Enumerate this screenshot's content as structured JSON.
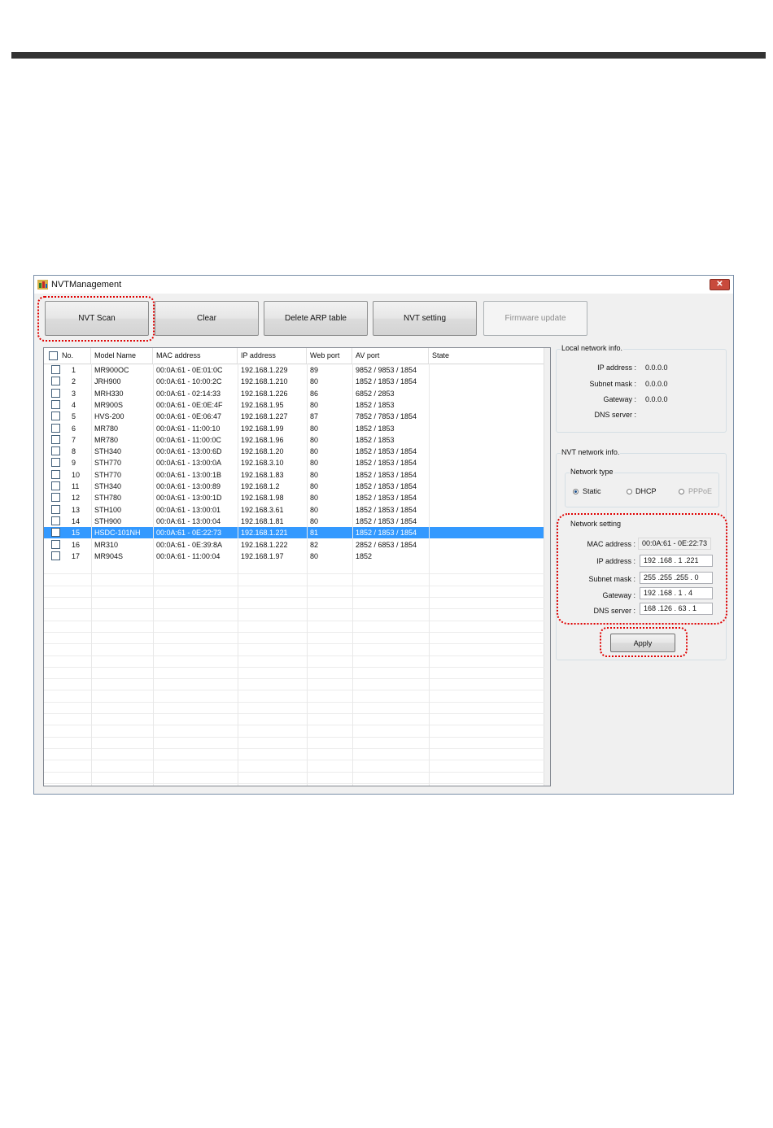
{
  "window": {
    "title": "NVTManagement",
    "close_glyph": "✕"
  },
  "toolbar": {
    "nvt_scan": "NVT Scan",
    "clear": "Clear",
    "delete_arp": "Delete ARP table",
    "nvt_setting": "NVT setting",
    "firmware_update": "Firmware update"
  },
  "table": {
    "headers": [
      "No.",
      "Model Name",
      "MAC address",
      "IP address",
      "Web port",
      "AV port",
      "State"
    ],
    "selected_index": 14,
    "rows": [
      [
        "1",
        "MR900OC",
        "00:0A:61 - 0E:01:0C",
        "192.168.1.229",
        "89",
        "9852 / 9853 / 1854",
        ""
      ],
      [
        "2",
        "JRH900",
        "00:0A:61 - 10:00:2C",
        "192.168.1.210",
        "80",
        "1852 / 1853 / 1854",
        ""
      ],
      [
        "3",
        "MRH330",
        "00:0A:61 - 02:14:33",
        "192.168.1.226",
        "86",
        "6852 / 2853",
        ""
      ],
      [
        "4",
        "MR900S",
        "00:0A:61 - 0E:0E:4F",
        "192.168.1.95",
        "80",
        "1852 / 1853",
        ""
      ],
      [
        "5",
        "HVS-200",
        "00:0A:61 - 0E:06:47",
        "192.168.1.227",
        "87",
        "7852 / 7853 / 1854",
        ""
      ],
      [
        "6",
        "MR780",
        "00:0A:61 - 11:00:10",
        "192.168.1.99",
        "80",
        "1852 / 1853",
        ""
      ],
      [
        "7",
        "MR780",
        "00:0A:61 - 11:00:0C",
        "192.168.1.96",
        "80",
        "1852 / 1853",
        ""
      ],
      [
        "8",
        "STH340",
        "00:0A:61 - 13:00:6D",
        "192.168.1.20",
        "80",
        "1852 / 1853 / 1854",
        ""
      ],
      [
        "9",
        "STH770",
        "00:0A:61 - 13:00:0A",
        "192.168.3.10",
        "80",
        "1852 / 1853 / 1854",
        ""
      ],
      [
        "10",
        "STH770",
        "00:0A:61 - 13:00:1B",
        "192.168.1.83",
        "80",
        "1852 / 1853 / 1854",
        ""
      ],
      [
        "11",
        "STH340",
        "00:0A:61 - 13:00:89",
        "192.168.1.2",
        "80",
        "1852 / 1853 / 1854",
        ""
      ],
      [
        "12",
        "STH780",
        "00:0A:61 - 13:00:1D",
        "192.168.1.98",
        "80",
        "1852 / 1853 / 1854",
        ""
      ],
      [
        "13",
        "STH100",
        "00:0A:61 - 13:00:01",
        "192.168.3.61",
        "80",
        "1852 / 1853 / 1854",
        ""
      ],
      [
        "14",
        "STH900",
        "00:0A:61 - 13:00:04",
        "192.168.1.81",
        "80",
        "1852 / 1853 / 1854",
        ""
      ],
      [
        "15",
        "HSDC-101NH",
        "00:0A:61 - 0E:22:73",
        "192.168.1.221",
        "81",
        "1852 / 1853 / 1854",
        ""
      ],
      [
        "16",
        "MR310",
        "00:0A:61 - 0E:39:8A",
        "192.168.1.222",
        "82",
        "2852 / 6853 / 1854",
        ""
      ],
      [
        "17",
        "MR904S",
        "00:0A:61 - 11:00:04",
        "192.168.1.97",
        "80",
        "1852",
        ""
      ]
    ]
  },
  "local_info": {
    "title": "Local network info.",
    "ip_label": "IP address :",
    "ip_value": "0.0.0.0",
    "subnet_label": "Subnet mask :",
    "subnet_value": "0.0.0.0",
    "gateway_label": "Gateway :",
    "gateway_value": "0.0.0.0",
    "dns_label": "DNS server :",
    "dns_value": ""
  },
  "nvt_info": {
    "title": "NVT network info.",
    "type_title": "Network type",
    "static": "Static",
    "dhcp": "DHCP",
    "pppoe": "PPPoE",
    "selected_type": "Static"
  },
  "network_setting": {
    "title": "Network setting",
    "mac_label": "MAC address :",
    "mac_value": "00:0A:61 - 0E:22:73",
    "ip_label": "IP address :",
    "ip_value": "192 .168 . 1  .221",
    "subnet_label": "Subnet mask :",
    "subnet_value": "255 .255 .255 . 0",
    "gateway_label": "Gateway :",
    "gateway_value": "192 .168 . 1  . 4",
    "dns_label": "DNS server :",
    "dns_value": "168 .126 . 63  . 1",
    "apply": "Apply"
  },
  "highlight_color": "#e00000",
  "selection_color": "#3399ff"
}
